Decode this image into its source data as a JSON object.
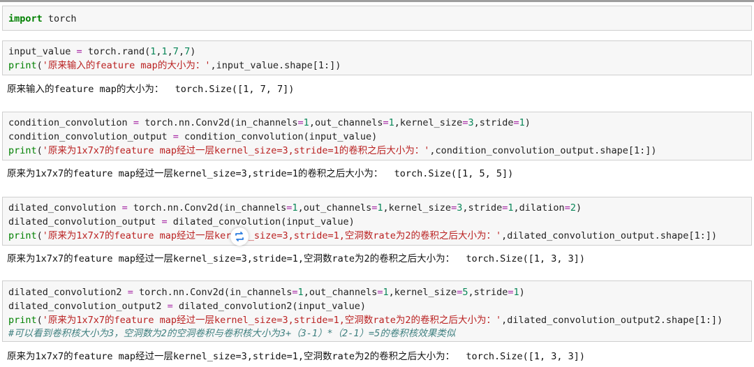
{
  "cell1": {
    "kw": "import",
    "rest": " torch"
  },
  "cell2": {
    "l1": {
      "a": "input_value ",
      "op": "=",
      "b": " torch.rand(",
      "n1": "1",
      "c1": ",",
      "n2": "1",
      "c2": ",",
      "n3": "7",
      "c3": ",",
      "n4": "7",
      "d": ")"
    },
    "l2": {
      "fn": "print",
      "p": "(",
      "s": "'原来输入的feature map的大小为：'",
      "rest": ",input_value.shape[1:])"
    },
    "output": "原来输入的feature map的大小为：  torch.Size([1, 7, 7])"
  },
  "cell3": {
    "l1": {
      "a": "condition_convolution ",
      "op": "=",
      "b": " torch.nn.Conv2d(in_channels",
      "e1": "=",
      "n1": "1",
      "c1": ",out_channels",
      "e2": "=",
      "n2": "1",
      "c2": ",kernel_size",
      "e3": "=",
      "n3": "3",
      "c3": ",stride",
      "e4": "=",
      "n4": "1",
      "d": ")"
    },
    "l2": {
      "a": "condition_convolution_output ",
      "op": "=",
      "b": " condition_convolution(input_value)"
    },
    "l3": {
      "fn": "print",
      "p": "(",
      "s": "'原来为1x7x7的feature map经过一层kernel_size=3,stride=1的卷积之后大小为：'",
      "rest": ",condition_convolution_output.shape[1:])"
    },
    "output": "原来为1x7x7的feature map经过一层kernel_size=3,stride=1的卷积之后大小为：  torch.Size([1, 5, 5])"
  },
  "cell4": {
    "l1": {
      "a": "dilated_convolution ",
      "op": "=",
      "b": " torch.nn.Conv2d(in_channels",
      "e1": "=",
      "n1": "1",
      "c1": ",out_channels",
      "e2": "=",
      "n2": "1",
      "c2": ",kernel_size",
      "e3": "=",
      "n3": "3",
      "c3": ",stride",
      "e4": "=",
      "n4": "1",
      "c4": ",dilation",
      "e5": "=",
      "n5": "2",
      "d": ")"
    },
    "l2": {
      "a": "dilated_convolution_output ",
      "op": "=",
      "b": " dilated_convolution(input_value)"
    },
    "l3": {
      "fn": "print",
      "p": "(",
      "s": "'原来为1x7x7的feature map经过一层kernel_size=3,stride=1,空洞数rate为2的卷积之后大小为：'",
      "rest": ",dilated_convolution_output.shape[1:])"
    },
    "output": "原来为1x7x7的feature map经过一层kernel_size=3,stride=1,空洞数rate为2的卷积之后大小为：  torch.Size([1, 3, 3])"
  },
  "cell5": {
    "l1": {
      "a": "dilated_convolution2 ",
      "op": "=",
      "b": " torch.nn.Conv2d(in_channels",
      "e1": "=",
      "n1": "1",
      "c1": ",out_channels",
      "e2": "=",
      "n2": "1",
      "c2": ",kernel_size",
      "e3": "=",
      "n3": "5",
      "c3": ",stride",
      "e4": "=",
      "n4": "1",
      "d": ")"
    },
    "l2": {
      "a": "dilated_convolution_output2 ",
      "op": "=",
      "b": " dilated_convolution2(input_value)"
    },
    "l3": {
      "fn": "print",
      "p": "(",
      "s": "'原来为1x7x7的feature map经过一层kernel_size=3,stride=1,空洞数rate为2的卷积之后大小为：'",
      "rest": ",dilated_convolution_output2.shape[1:])"
    },
    "l4": "#可以看到卷积核大小为3，空洞数为2的空洞卷积与卷积核大小为3+（3-1）*（2-1）=5的卷积核效果类似",
    "output": "原来为1x7x7的feature map经过一层kernel_size=3,stride=1,空洞数rate为2的卷积之后大小为：  torch.Size([1, 3, 3])"
  },
  "icons": {
    "loader": "refresh-icon"
  },
  "colors": {
    "keyword": "#008000",
    "string": "#ba2121",
    "number": "#098658",
    "operator": "#a626a4",
    "comment": "#408080"
  }
}
